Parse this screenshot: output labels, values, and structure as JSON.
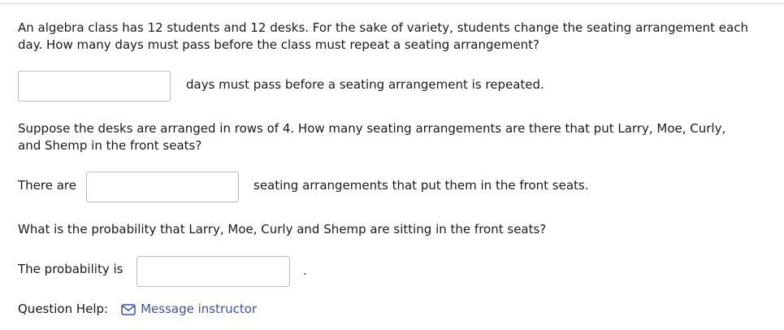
{
  "question": {
    "intro": "An algebra class has 12 students and 12 desks. For the sake of variety, students change the seating arrangement each day. How many days must pass before the class must repeat a seating arrangement?",
    "part1": {
      "value": "",
      "suffix": "days must pass before a seating arrangement is repeated."
    },
    "part2_prompt": "Suppose the desks are arranged in rows of 4. How many seating arrangements are there that put Larry, Moe, Curly, and Shemp in the front seats?",
    "part2": {
      "prefix": "There are",
      "value": "",
      "suffix": "seating arrangements that put them in the front seats."
    },
    "part3_prompt": "What is the probability that Larry, Moe, Curly and Shemp are sitting in the front seats?",
    "part3": {
      "prefix": "The probability is",
      "value": "",
      "suffix": "."
    }
  },
  "help": {
    "label": "Question Help:",
    "link_text": "Message instructor",
    "icon": "envelope-icon",
    "link_color": "#3b4fb8"
  }
}
